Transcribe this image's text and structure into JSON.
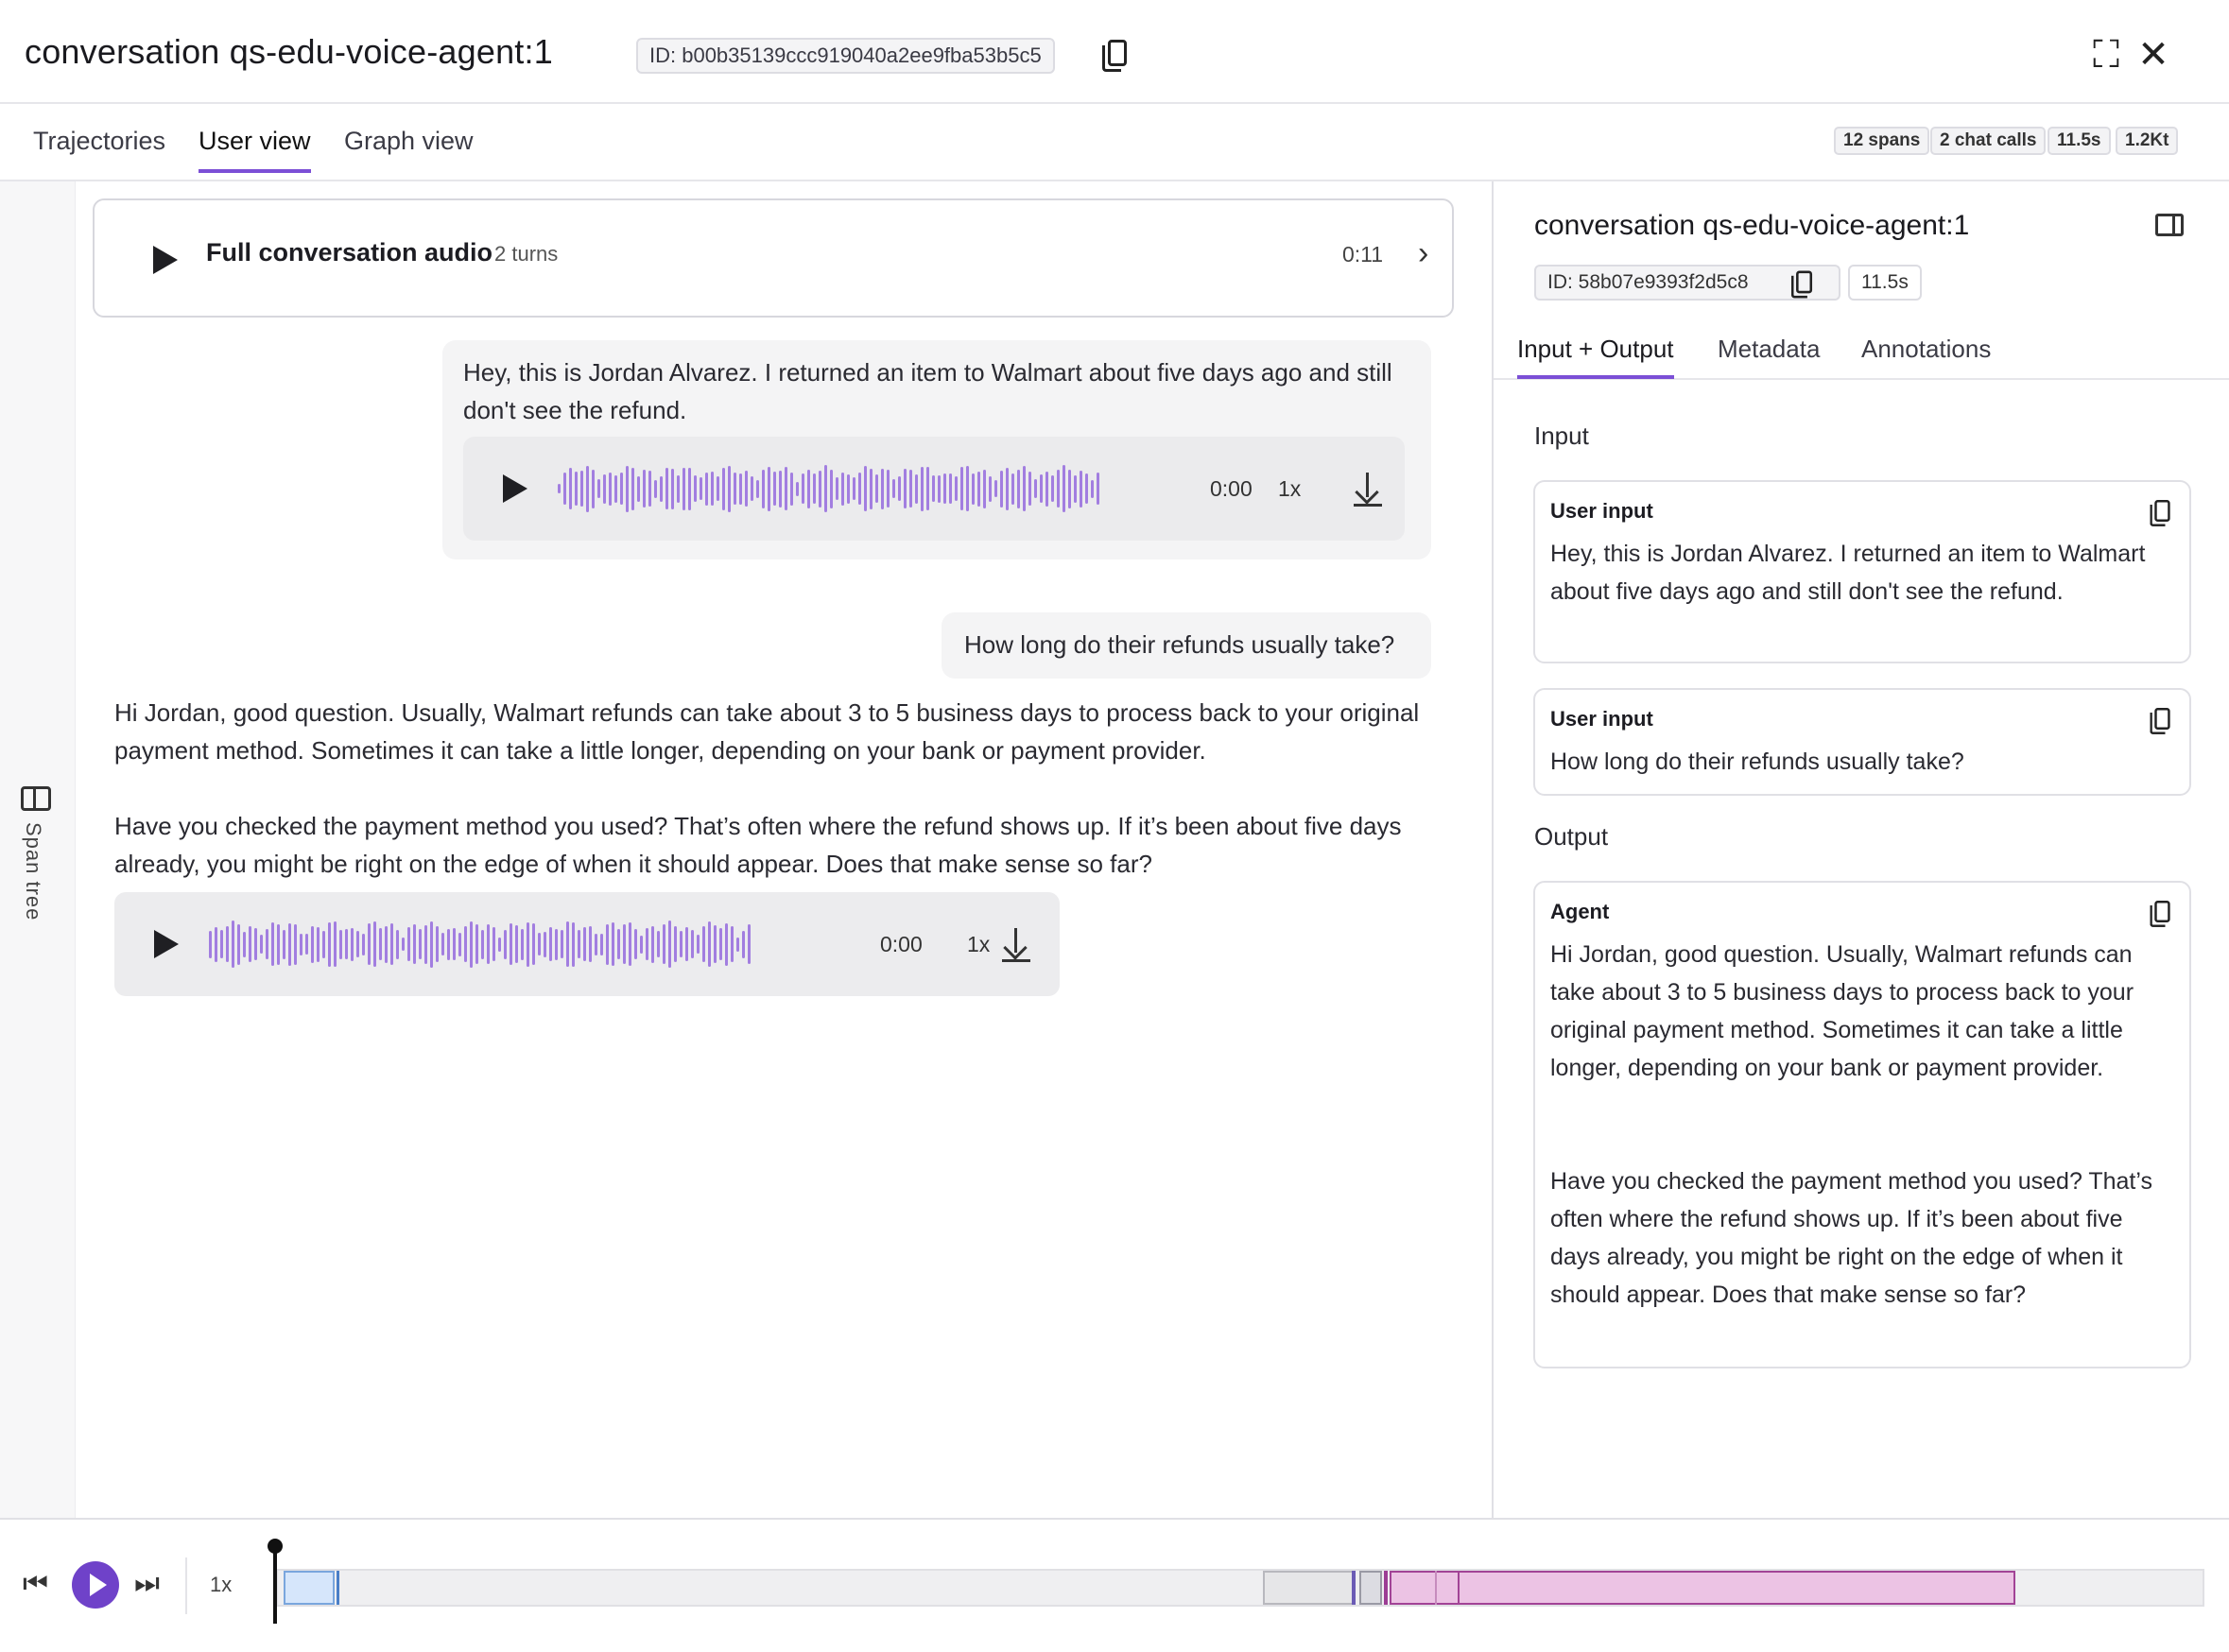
{
  "header": {
    "title": "conversation qs-edu-voice-agent:1",
    "id_chip": "ID: b00b35139ccc919040a2ee9fba53b5c5"
  },
  "tabs": [
    {
      "label": "Trajectories",
      "active": false
    },
    {
      "label": "User view",
      "active": true
    },
    {
      "label": "Graph view",
      "active": false
    }
  ],
  "stats": [
    "12 spans",
    "2 chat calls",
    "11.5s",
    "1.2Kt"
  ],
  "rail": {
    "label": "Span tree"
  },
  "full_audio": {
    "label": "Full conversation audio",
    "turns": "2 turns",
    "duration": "0:11"
  },
  "messages": [
    {
      "role": "user",
      "text": "Hey, this is Jordan Alvarez. I returned an item to Walmart about five days ago and still don't see the refund.",
      "player": {
        "time": "0:00",
        "speed": "1x"
      }
    },
    {
      "role": "user",
      "text": "How long do their refunds usually take?"
    },
    {
      "role": "agent",
      "paragraphs": [
        "Hi Jordan, good question. Usually, Walmart refunds can take about 3 to 5 business days to process back to your original payment method. Sometimes it can take a little longer, depending on your bank or payment provider.",
        "Have you checked the payment method you used? That’s often where the refund shows up. If it’s been about five days already, you might be right on the edge of when it should appear. Does that make sense so far?"
      ],
      "player": {
        "time": "0:00",
        "speed": "1x"
      }
    }
  ],
  "right_panel": {
    "title": "conversation qs-edu-voice-agent:1",
    "id_chip": "ID: 58b07e9393f2d5c8",
    "duration": "11.5s",
    "tabs": [
      {
        "label": "Input + Output",
        "active": true
      },
      {
        "label": "Metadata",
        "active": false
      },
      {
        "label": "Annotations",
        "active": false
      }
    ],
    "input_heading": "Input",
    "output_heading": "Output",
    "inputs": [
      {
        "role": "User input",
        "text": "Hey, this is Jordan Alvarez. I returned an item to Walmart about five days ago and still don't see the refund."
      },
      {
        "role": "User input",
        "text": "How long do their refunds usually take?"
      }
    ],
    "output": {
      "role": "Agent",
      "paragraphs": [
        "Hi Jordan, good question. Usually, Walmart refunds can take about 3 to 5 business days to process back to your original payment method. Sometimes it can take a little longer, depending on your bank or payment provider.",
        "Have you checked the payment method you used? That’s often where the refund shows up. If it’s been about five days already, you might be right on the edge of when it should appear. Does that make sense so far?"
      ]
    }
  },
  "bottom_bar": {
    "speed": "1x",
    "icons": {
      "prev": "skip-back-icon",
      "play": "play-icon",
      "next": "skip-forward-icon"
    },
    "colors": {
      "accent": "#6f42c9",
      "user_segment": "#d6e6fb",
      "agent_segment": "#ecc3e4",
      "waveform": "#a27ee0"
    }
  }
}
